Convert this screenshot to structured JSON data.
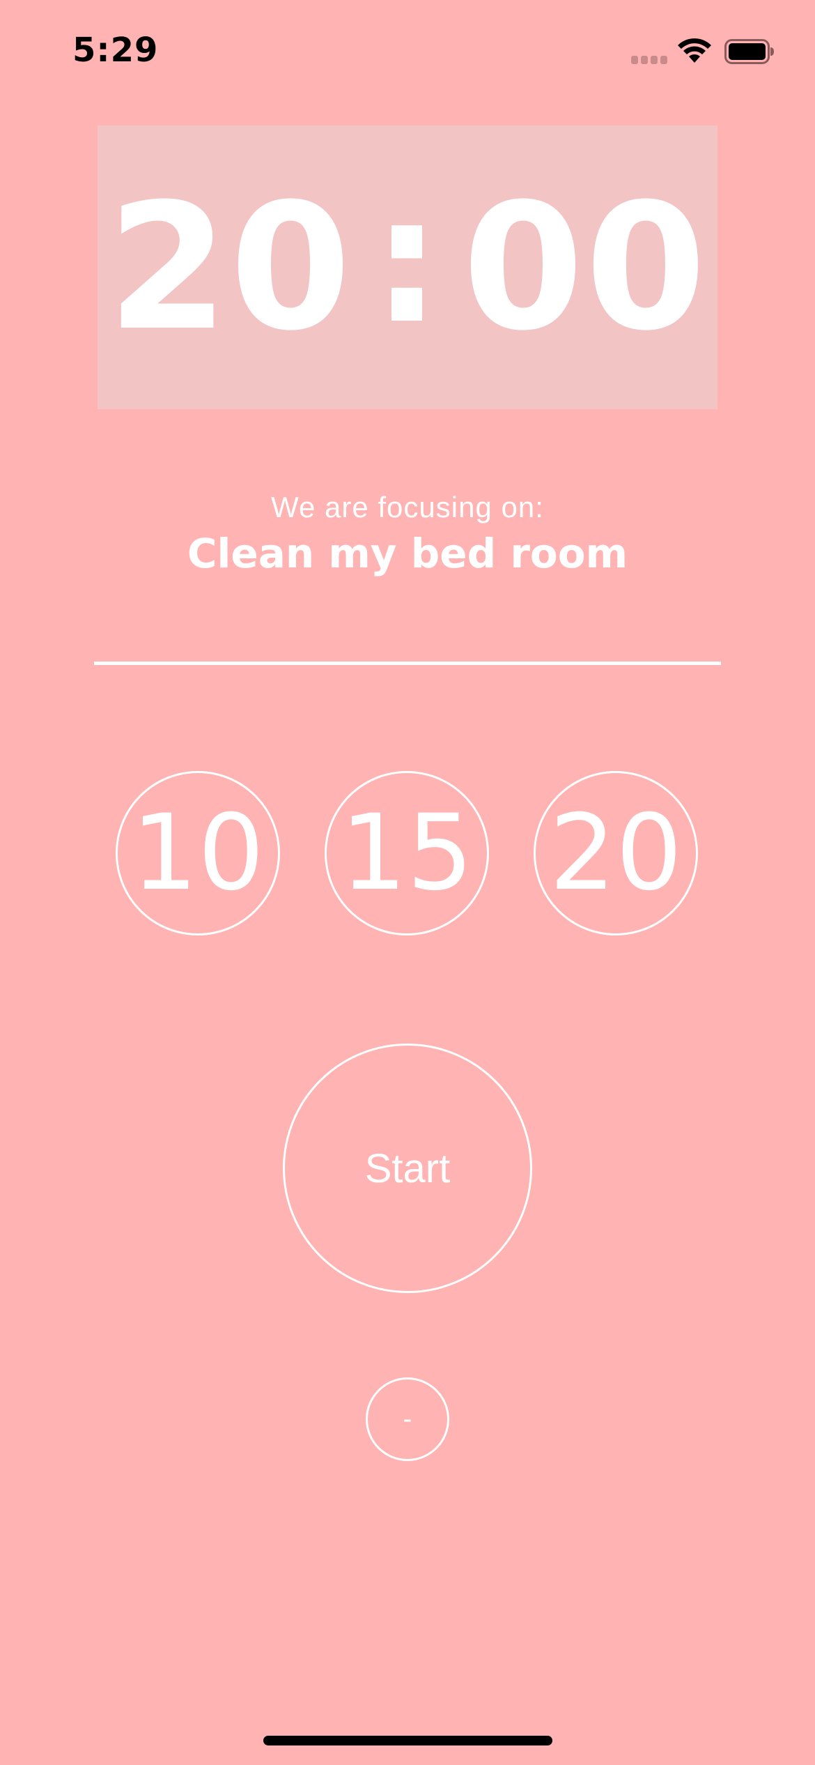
{
  "status_bar": {
    "time": "5:29",
    "icons": [
      "signal-icon",
      "wifi-icon",
      "battery-icon"
    ]
  },
  "timer": {
    "minutes": "20",
    "separator": ":",
    "seconds": "00"
  },
  "focus": {
    "caption": "We are focusing on:",
    "task": "Clean my bed room"
  },
  "presets": [
    {
      "label": "10"
    },
    {
      "label": "15"
    },
    {
      "label": "20"
    }
  ],
  "controls": {
    "start_label": "Start",
    "minus_label": "-"
  },
  "colors": {
    "background": "#ffb3b3",
    "timer_box": "#f2c4c4",
    "foreground": "#ffffff"
  }
}
